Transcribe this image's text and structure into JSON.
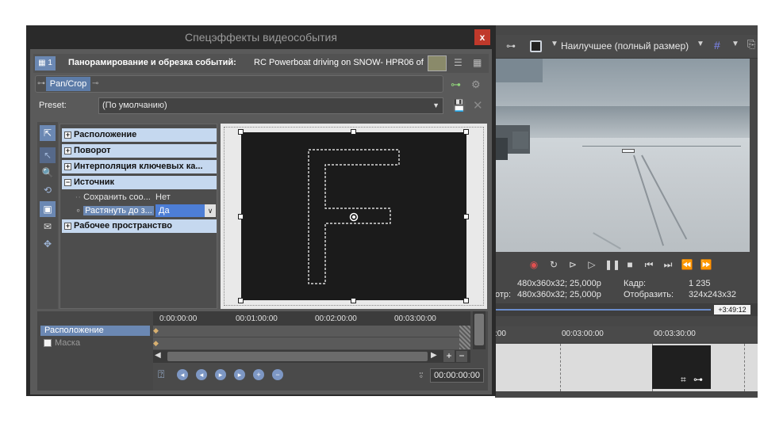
{
  "dialog": {
    "title": "Спецэффекты видеособытия",
    "close_label": "x",
    "header_label": "Панорамирование и обрезка событий:",
    "event_name": "RC Powerboat driving on SNOW- HPR06 of",
    "chain_button": "Pan/Crop",
    "preset_label": "Preset:",
    "preset_value": "(По умолчанию)",
    "track_number": "1"
  },
  "properties": {
    "categories": [
      {
        "label": "Расположение",
        "sign": "+"
      },
      {
        "label": "Поворот",
        "sign": "+"
      },
      {
        "label": "Интерполяция ключевых ка...",
        "sign": "+"
      },
      {
        "label": "Источник",
        "sign": "−"
      },
      {
        "label": "Рабочее пространство",
        "sign": "+"
      }
    ],
    "source_rows": [
      {
        "name": "Сохранить соо...",
        "value": "Нет"
      },
      {
        "name": "Растянуть до з...",
        "value": "Да"
      }
    ]
  },
  "keyframes": {
    "tracks": [
      "Расположение",
      "Маска"
    ],
    "ruler": [
      "0:00:00:00",
      "00:01:00:00",
      "00:02:00:00",
      "00:03:00:00"
    ],
    "time": "00:00:00:00"
  },
  "main": {
    "quality_label": "Наилучшее (полный размер)",
    "info": {
      "row1_left": "480x360x32; 25,000p",
      "row1_label": "Кадр:",
      "row1_value": "1 235",
      "row2_prefix": "отр:",
      "row2_left": "480x360x32; 25,000p",
      "row2_label": "Отобразить:",
      "row2_value": "324x243x32"
    },
    "timecode": "+3:49:12",
    "ruler": [
      ":00",
      "00:03:00:00",
      "00:03:30:00"
    ]
  },
  "colors": {
    "accent": "#5d7ca8",
    "category_bg": "#c5d8ef",
    "close": "#c0392b"
  }
}
